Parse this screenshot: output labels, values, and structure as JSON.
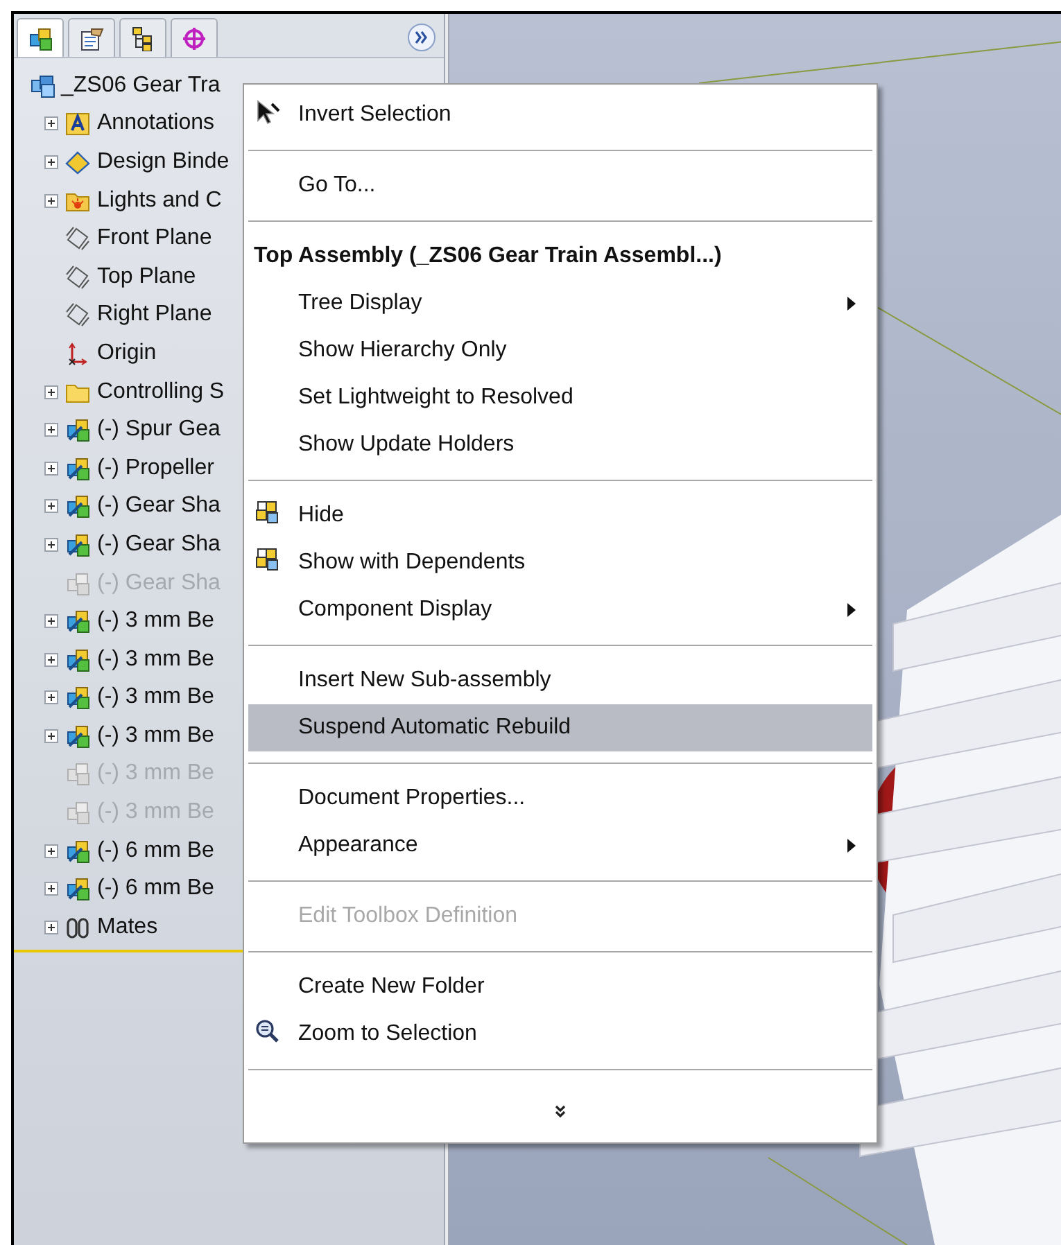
{
  "tabs": [
    {
      "kind": "feature-tree",
      "selected": true
    },
    {
      "kind": "property",
      "selected": false
    },
    {
      "kind": "configuration",
      "selected": false
    },
    {
      "kind": "dimxpert",
      "selected": false
    }
  ],
  "tree": {
    "root": {
      "label": "_ZS06 Gear Tra",
      "kind": "assembly",
      "children": [
        {
          "label": "Annotations",
          "kind": "annotations",
          "expandable": true,
          "suppressed": false
        },
        {
          "label": "Design Binde",
          "kind": "binder",
          "expandable": true,
          "suppressed": false
        },
        {
          "label": "Lights and C",
          "kind": "lights",
          "expandable": true,
          "suppressed": false
        },
        {
          "label": "Front Plane",
          "kind": "plane",
          "expandable": false,
          "suppressed": false
        },
        {
          "label": "Top Plane",
          "kind": "plane",
          "expandable": false,
          "suppressed": false
        },
        {
          "label": "Right Plane",
          "kind": "plane",
          "expandable": false,
          "suppressed": false
        },
        {
          "label": "Origin",
          "kind": "origin",
          "expandable": false,
          "suppressed": false
        },
        {
          "label": "Controlling S",
          "kind": "folder",
          "expandable": true,
          "suppressed": false
        },
        {
          "label": "(-) Spur Gea",
          "kind": "component",
          "expandable": true,
          "suppressed": false
        },
        {
          "label": "(-) Propeller",
          "kind": "component",
          "expandable": true,
          "suppressed": false
        },
        {
          "label": "(-) Gear Sha",
          "kind": "component",
          "expandable": true,
          "suppressed": false
        },
        {
          "label": "(-) Gear Sha",
          "kind": "component",
          "expandable": true,
          "suppressed": false
        },
        {
          "label": "(-) Gear Sha",
          "kind": "component",
          "expandable": false,
          "suppressed": true
        },
        {
          "label": "(-) 3 mm Be",
          "kind": "component",
          "expandable": true,
          "suppressed": false
        },
        {
          "label": "(-) 3 mm Be",
          "kind": "component",
          "expandable": true,
          "suppressed": false
        },
        {
          "label": "(-) 3 mm Be",
          "kind": "component",
          "expandable": true,
          "suppressed": false
        },
        {
          "label": "(-) 3 mm Be",
          "kind": "component",
          "expandable": true,
          "suppressed": false
        },
        {
          "label": "(-) 3 mm Be",
          "kind": "component",
          "expandable": false,
          "suppressed": true
        },
        {
          "label": "(-) 3 mm Be",
          "kind": "component",
          "expandable": false,
          "suppressed": true
        },
        {
          "label": "(-) 6 mm Be",
          "kind": "component",
          "expandable": true,
          "suppressed": false
        },
        {
          "label": "(-) 6 mm Be",
          "kind": "component",
          "expandable": true,
          "suppressed": false
        },
        {
          "label": "Mates",
          "kind": "mates",
          "expandable": true,
          "suppressed": false
        }
      ]
    }
  },
  "context_menu": {
    "items": [
      {
        "kind": "cursor-item",
        "label": "Invert Selection",
        "submenu": false,
        "disabled": false,
        "selected": false
      },
      {
        "kind": "separator"
      },
      {
        "kind": "item",
        "label": "Go To...",
        "submenu": false,
        "disabled": false,
        "selected": false
      },
      {
        "kind": "separator"
      },
      {
        "kind": "header",
        "label": "Top Assembly (_ZS06 Gear Train Assembl...)"
      },
      {
        "kind": "item",
        "label": "Tree Display",
        "submenu": true,
        "disabled": false,
        "selected": false
      },
      {
        "kind": "item",
        "label": "Show Hierarchy Only",
        "submenu": false,
        "disabled": false,
        "selected": false
      },
      {
        "kind": "item",
        "label": "Set Lightweight to Resolved",
        "submenu": false,
        "disabled": false,
        "selected": false
      },
      {
        "kind": "item",
        "label": "Show Update Holders",
        "submenu": false,
        "disabled": false,
        "selected": false
      },
      {
        "kind": "separator"
      },
      {
        "kind": "components-item",
        "label": "Hide",
        "submenu": false,
        "disabled": false,
        "selected": false
      },
      {
        "kind": "components-item",
        "label": "Show with Dependents",
        "submenu": false,
        "disabled": false,
        "selected": false
      },
      {
        "kind": "item",
        "label": "Component Display",
        "submenu": true,
        "disabled": false,
        "selected": false
      },
      {
        "kind": "separator"
      },
      {
        "kind": "item",
        "label": "Insert New Sub-assembly",
        "submenu": false,
        "disabled": false,
        "selected": false
      },
      {
        "kind": "item",
        "label": "Suspend Automatic Rebuild",
        "submenu": false,
        "disabled": false,
        "selected": true
      },
      {
        "kind": "separator"
      },
      {
        "kind": "item",
        "label": "Document Properties...",
        "submenu": false,
        "disabled": false,
        "selected": false
      },
      {
        "kind": "item",
        "label": "Appearance",
        "submenu": true,
        "disabled": false,
        "selected": false
      },
      {
        "kind": "separator"
      },
      {
        "kind": "item",
        "label": "Edit Toolbox Definition",
        "submenu": false,
        "disabled": true,
        "selected": false
      },
      {
        "kind": "separator"
      },
      {
        "kind": "item",
        "label": "Create New Folder",
        "submenu": false,
        "disabled": false,
        "selected": false
      },
      {
        "kind": "zoom-item",
        "label": "Zoom to Selection",
        "submenu": false,
        "disabled": false,
        "selected": false
      },
      {
        "kind": "separator"
      },
      {
        "kind": "more"
      }
    ]
  }
}
